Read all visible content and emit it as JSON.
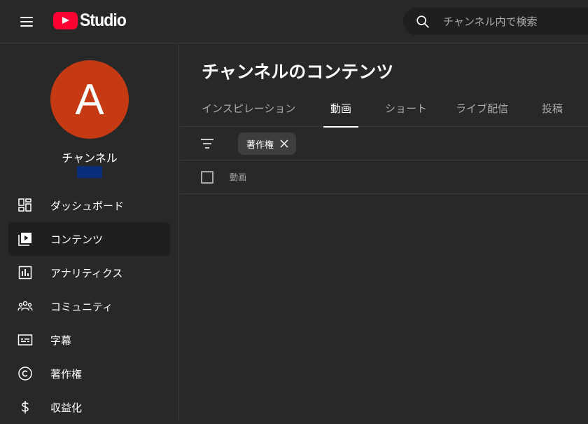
{
  "header": {
    "logo_text": "Studio",
    "search_placeholder": "チャンネル内で検索"
  },
  "sidebar": {
    "avatar_letter": "A",
    "channel_name": "チャンネル",
    "items": [
      {
        "label": "ダッシュボード",
        "icon": "dashboard-icon"
      },
      {
        "label": "コンテンツ",
        "icon": "content-icon",
        "active": true
      },
      {
        "label": "アナリティクス",
        "icon": "analytics-icon"
      },
      {
        "label": "コミュニティ",
        "icon": "community-icon"
      },
      {
        "label": "字幕",
        "icon": "subtitles-icon"
      },
      {
        "label": "著作権",
        "icon": "copyright-icon"
      },
      {
        "label": "収益化",
        "icon": "dollar-icon"
      }
    ]
  },
  "main": {
    "title": "チャンネルのコンテンツ",
    "tabs": [
      {
        "label": "インスピレーション"
      },
      {
        "label": "動画",
        "active": true
      },
      {
        "label": "ショート"
      },
      {
        "label": "ライブ配信"
      },
      {
        "label": "投稿"
      }
    ],
    "filter_chip": "著作権",
    "column_video": "動画"
  },
  "colors": {
    "background": "#282828",
    "avatar": "#c53a13",
    "brand_red": "#ff0033",
    "badge": "#0b2e7a"
  }
}
